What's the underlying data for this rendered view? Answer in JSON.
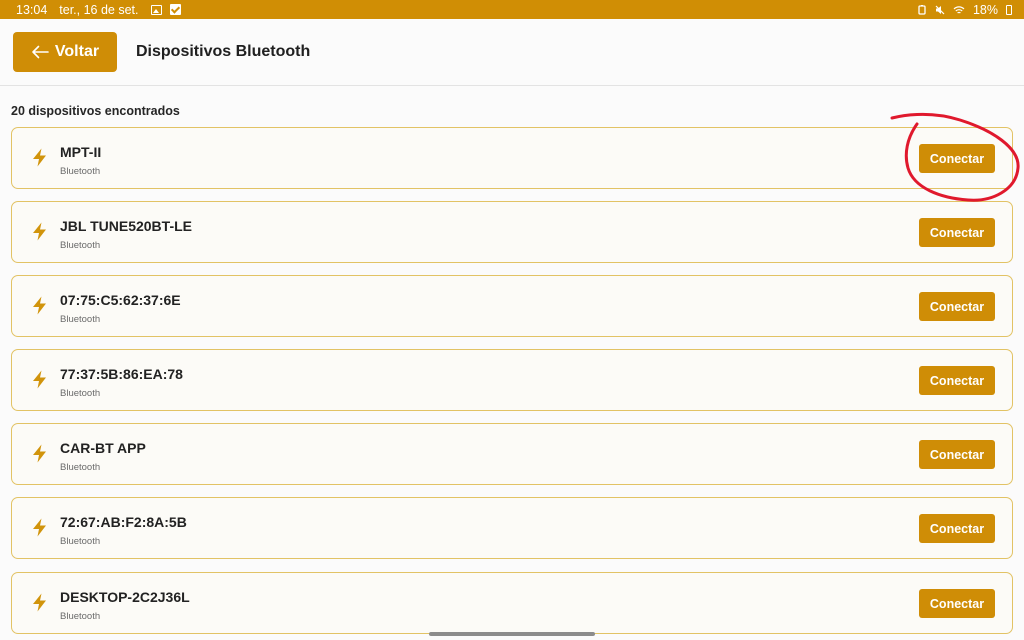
{
  "status_bar": {
    "time": "13:04",
    "date": "ter., 16 de set.",
    "battery": "18%",
    "bg_color": "#d08e05"
  },
  "header": {
    "back_label": "Voltar",
    "title": "Dispositivos Bluetooth",
    "accent": "#cf8d06"
  },
  "list": {
    "count_label": "20 dispositivos encontrados",
    "devices": [
      {
        "name": "MPT-II",
        "type": "Bluetooth",
        "action": "Conectar",
        "icon": "bolt-icon"
      },
      {
        "name": "JBL TUNE520BT-LE",
        "type": "Bluetooth",
        "action": "Conectar",
        "icon": "bolt-icon"
      },
      {
        "name": "07:75:C5:62:37:6E",
        "type": "Bluetooth",
        "action": "Conectar",
        "icon": "bolt-icon"
      },
      {
        "name": "77:37:5B:86:EA:78",
        "type": "Bluetooth",
        "action": "Conectar",
        "icon": "bolt-icon"
      },
      {
        "name": "CAR-BT APP",
        "type": "Bluetooth",
        "action": "Conectar",
        "icon": "bolt-icon"
      },
      {
        "name": "72:67:AB:F2:8A:5B",
        "type": "Bluetooth",
        "action": "Conectar",
        "icon": "bolt-icon"
      },
      {
        "name": "DESKTOP-2C2J36L",
        "type": "Bluetooth",
        "action": "Conectar",
        "icon": "bolt-icon"
      }
    ]
  },
  "annotation": {
    "color": "#e0192d"
  }
}
